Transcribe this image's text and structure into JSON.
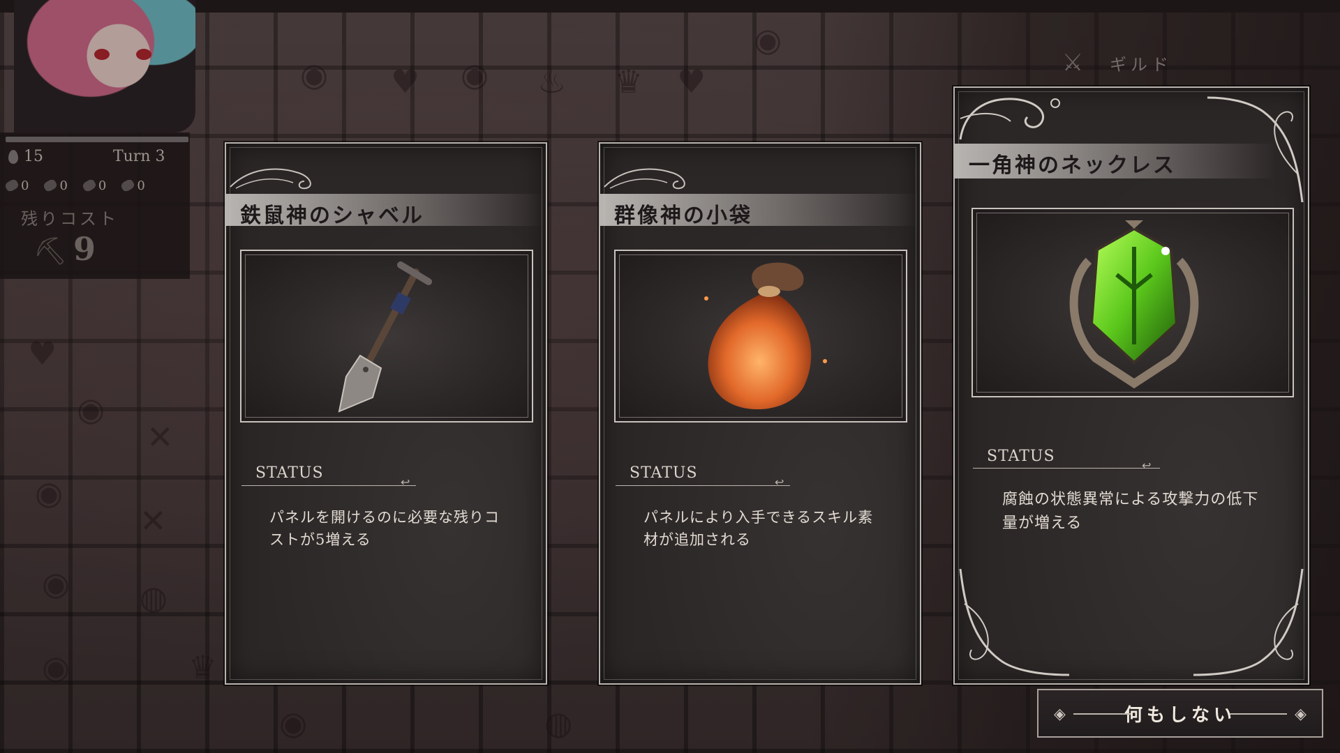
{
  "hud": {
    "stat_value": "15",
    "turn_label": "Turn 3",
    "resources": [
      "0",
      "0",
      "0",
      "0"
    ],
    "cost_label": "残りコスト",
    "cost_value": "9"
  },
  "top_right": {
    "guild_label": "ギルド",
    "guild_icon": "crossed-swords-icon"
  },
  "cards": [
    {
      "name": "鉄鼠神のシャベル",
      "item_icon": "shovel-icon",
      "status_label": "STATUS",
      "description": "パネルを開けるのに必要な残りコストが5増える"
    },
    {
      "name": "群像神の小袋",
      "item_icon": "pouch-icon",
      "status_label": "STATUS",
      "description": "パネルにより入手できるスキル素材が追加される"
    },
    {
      "name": "一角神のネックレス",
      "item_icon": "green-gem-necklace-icon",
      "status_label": "STATUS",
      "description": "腐蝕の状態異常による攻撃力の低下量が増える"
    }
  ],
  "actions": {
    "nothing_label": "何もしない"
  },
  "colors": {
    "card_bg": "#2c2727",
    "band": "#c8c4c0",
    "accent_green": "#6fd12a",
    "accent_orange": "#e2692a"
  }
}
